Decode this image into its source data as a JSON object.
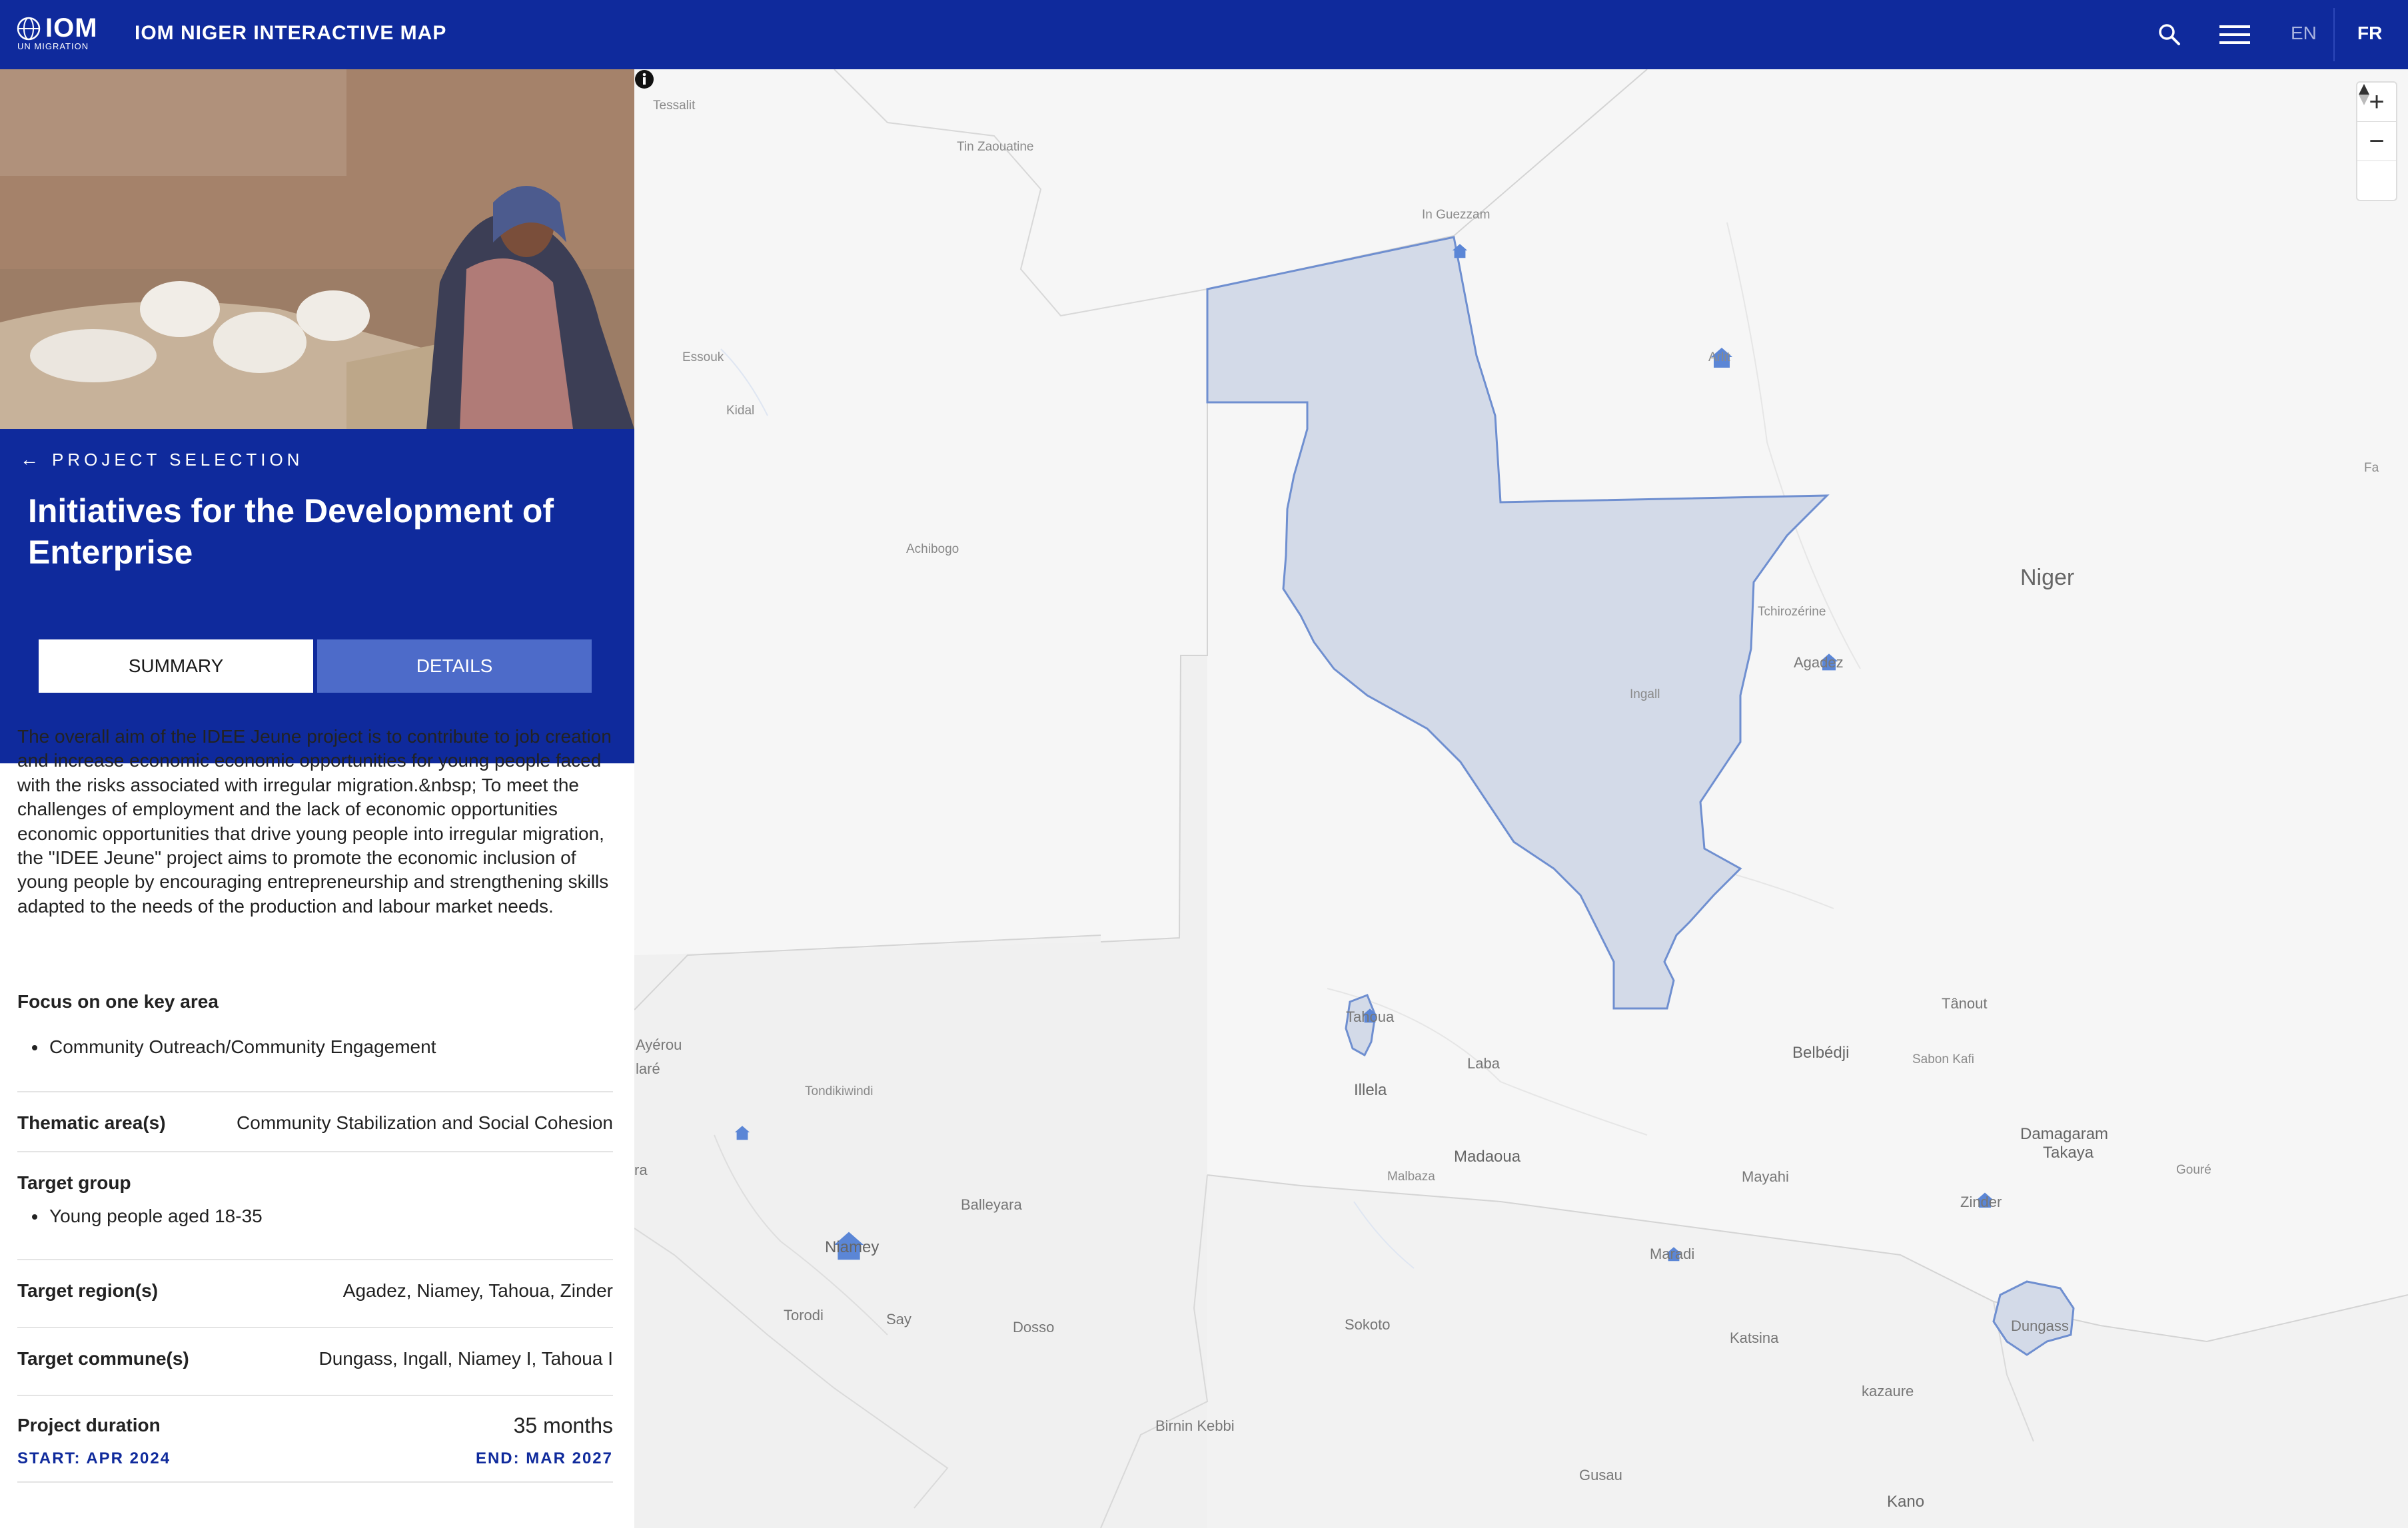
{
  "header": {
    "logo_text": "IOM",
    "logo_subtext": "UN MIGRATION",
    "title": "IOM NIGER INTERACTIVE MAP",
    "lang_en": "EN",
    "lang_fr": "FR",
    "icons": [
      "search-icon",
      "menu-icon"
    ]
  },
  "project": {
    "back_label": "PROJECT SELECTION",
    "title": "Initiatives for the Development of Enterprise",
    "tabs": [
      {
        "label": "SUMMARY",
        "active": true
      },
      {
        "label": "DETAILS",
        "active": false
      }
    ],
    "summary": "The overall aim of the IDEE Jeune project is to contribute to job creation and increase economic economic opportunities for young people faced with the risks associated with irregular migration.&nbsp; To meet the challenges of employment and the lack of economic opportunities economic opportunities that drive young people into irregular migration, the \"IDEE Jeune\" project aims to promote the economic inclusion of young people by encouraging entrepreneurship and strengthening skills adapted to the needs of the production and labour market needs.",
    "focus_label": "Focus on one key area",
    "focus_items": [
      "Community Outreach/Community Engagement"
    ],
    "thematic_label": "Thematic area(s)",
    "thematic_value": "Community Stabilization and Social Cohesion",
    "target_group_label": "Target group",
    "target_group_items": [
      "Young people aged 18-35"
    ],
    "regions_label": "Target region(s)",
    "regions_value": "Agadez, Niamey, Tahoua, Zinder",
    "communes_label": "Target commune(s)",
    "communes_value": "Dungass, Ingall, Niamey I, Tahoua I",
    "duration_label": "Project duration",
    "duration_value": "35 months",
    "start": "START: APR 2024",
    "end": "END: MAR 2027"
  },
  "map": {
    "country_label": "Niger",
    "places": {
      "tessalit": "Tessalit",
      "tinzaouatine": "Tin Zaouatine",
      "inguezzam": "In Guezzam",
      "essouk": "Essouk",
      "kidal": "Kidal",
      "achibogo": "Achibogo",
      "arlit": "Arlit",
      "tchirozerine": "Tchirozérine",
      "agadez": "Agadez",
      "ingall": "Ingall",
      "fa": "Fa",
      "tanout": "Tânout",
      "tahoua": "Tahoua",
      "ayerou": "Ayérou",
      "lare": "laré",
      "tondikiwindi": "Tondikiwindi",
      "laba": "Laba",
      "illela": "Illela",
      "belbedji": "Belbédji",
      "sabonkafi": "Sabon Kafi",
      "ra": "ra",
      "madaoua": "Madaoua",
      "malbaza": "Malbaza",
      "mayahi": "Mayahi",
      "damagaram": "Damagaram",
      "takaya": "Takaya",
      "goure": "Gouré",
      "balleyara": "Balleyara",
      "zinder": "Zinder",
      "niamey": "Niamey",
      "maradi": "Maradi",
      "torodi": "Torodi",
      "say": "Say",
      "dosso": "Dosso",
      "sokoto": "Sokoto",
      "katsina": "Katsina",
      "dungass": "Dungass",
      "kazaure": "kazaure",
      "birninkebbi": "Birnin Kebbi",
      "gusau": "Gusau",
      "kano": "Kano"
    },
    "controls": [
      "zoom-in",
      "zoom-out",
      "reset-north"
    ],
    "colors": {
      "highlight_fill": "#d3dae8",
      "highlight_stroke": "#6f8fd0",
      "marker": "#5b86d6"
    }
  }
}
